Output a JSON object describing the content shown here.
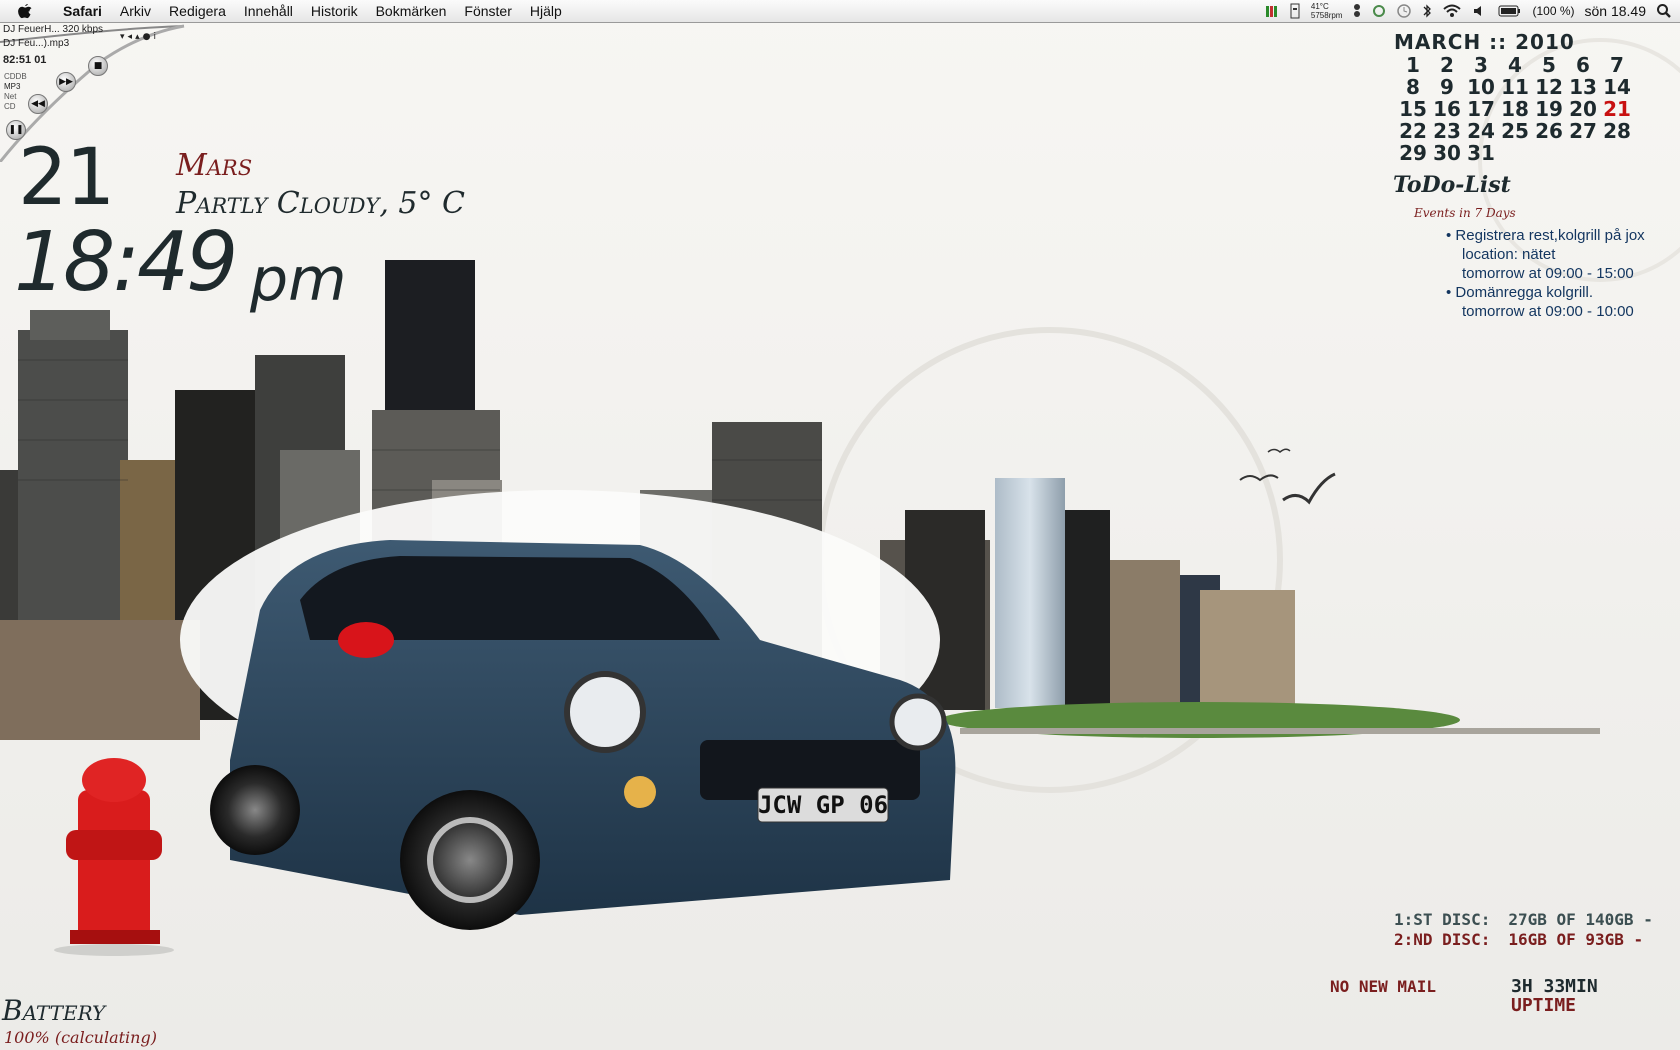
{
  "menubar": {
    "items": [
      {
        "label": "Safari",
        "bold": true
      },
      {
        "label": "Arkiv"
      },
      {
        "label": "Redigera"
      },
      {
        "label": "Innehåll"
      },
      {
        "label": "Historik"
      },
      {
        "label": "Bokmärken"
      },
      {
        "label": "Fönster"
      },
      {
        "label": "Hjälp"
      }
    ],
    "temp": "41°C",
    "rpm": "5758rpm",
    "battery_pct": "(100 %)",
    "clock": "sön 18.49",
    "icons": [
      "apple-icon",
      "cpu-meter-icon",
      "temperature-icon",
      "bluetooth-icon",
      "wifi-icon",
      "volume-icon",
      "battery-icon",
      "spotlight-icon",
      "time-machine-icon",
      "growl-icon"
    ]
  },
  "itunes": {
    "track": "DJ FeuerH... 320 kbps",
    "file": "DJ Feu...).mp3",
    "time": "82:51  01",
    "sources": [
      "CDDB",
      "MP3",
      "Net",
      "CD"
    ]
  },
  "clock": {
    "day": "21",
    "time": "18:49",
    "ampm": "pm"
  },
  "weather": {
    "month": "Mars",
    "condition": "Partly Cloudy, 5° C"
  },
  "calendar": {
    "title": "MARCH :: 2010",
    "today": "21",
    "days": [
      "1",
      "2",
      "3",
      "4",
      "5",
      "6",
      "7",
      "8",
      "9",
      "10",
      "11",
      "12",
      "13",
      "14",
      "15",
      "16",
      "17",
      "18",
      "19",
      "20",
      "21",
      "22",
      "23",
      "24",
      "25",
      "26",
      "27",
      "28",
      "29",
      "30",
      "31"
    ]
  },
  "todo": {
    "title": "ToDo-List",
    "subtitle": "Events in 7 Days",
    "events": [
      {
        "title": "Registrera rest,kolgrill på jox",
        "location": "location: nätet",
        "when": "tomorrow at 09:00 - 15:00"
      },
      {
        "title": "Domänregga kolgrill.",
        "when": "tomorrow at 09:00 - 10:00"
      }
    ]
  },
  "disks": [
    {
      "label": "1:ST DISC:",
      "value": "27GB OF 140GB -"
    },
    {
      "label": "2:ND DISC:",
      "value": "16GB OF 93GB -"
    }
  ],
  "mail": "NO NEW MAIL",
  "uptime": {
    "value": "3H 33MIN",
    "label": "UPTIME"
  },
  "battery": {
    "title": "Battery",
    "value": "100% (calculating)"
  },
  "wallpaper": {
    "plate": "JCW GP 06"
  }
}
